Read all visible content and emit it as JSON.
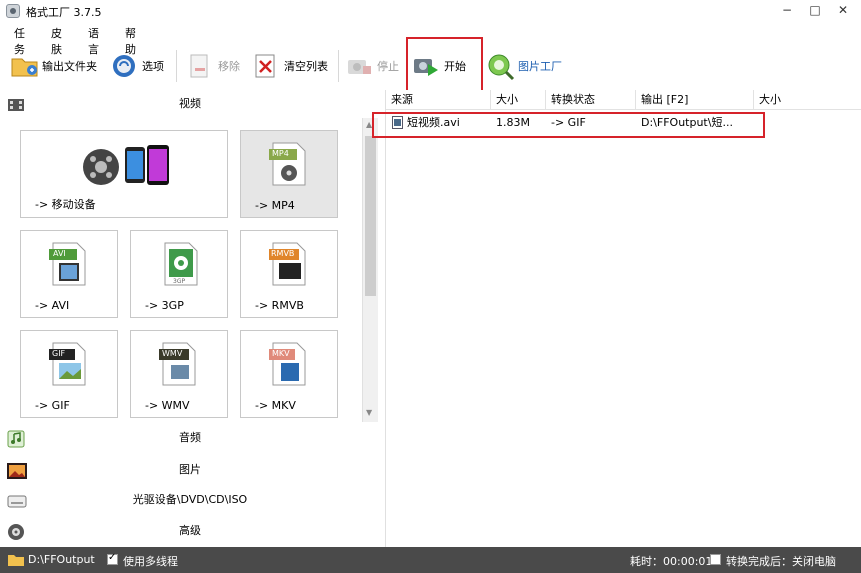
{
  "window": {
    "title": "格式工厂 3.7.5",
    "minimize": "−",
    "maximize": "□",
    "close": "✕"
  },
  "menu": [
    "任务",
    "皮肤",
    "语言",
    "帮助"
  ],
  "toolbar": {
    "output_folder": "输出文件夹",
    "options": "选项",
    "remove": "移除",
    "clear_list": "清空列表",
    "stop": "停止",
    "start": "开始",
    "picture_factory": "图片工厂"
  },
  "categories": {
    "video": "视频",
    "audio": "音频",
    "picture": "图片",
    "disc": "光驱设备\\DVD\\CD\\ISO",
    "advanced": "高级"
  },
  "video_tiles": [
    {
      "label": "-> 移动设备",
      "badge": ""
    },
    {
      "label": "-> MP4",
      "badge": "MP4"
    },
    {
      "label": "-> AVI",
      "badge": "AVI"
    },
    {
      "label": "-> 3GP",
      "badge": "3GP"
    },
    {
      "label": "-> RMVB",
      "badge": "RMVB"
    },
    {
      "label": "-> GIF",
      "badge": "GIF"
    },
    {
      "label": "-> WMV",
      "badge": "WMV"
    },
    {
      "label": "-> MKV",
      "badge": "MKV"
    }
  ],
  "table": {
    "headers": [
      "来源",
      "大小",
      "转换状态",
      "输出 [F2]",
      "大小"
    ],
    "rows": [
      {
        "source": "短视频.avi",
        "size": "1.83M",
        "status": "-> GIF",
        "output": "D:\\FFOutput\\短..."
      }
    ]
  },
  "statusbar": {
    "path": "D:\\FFOutput",
    "multithread": "使用多线程",
    "elapsed": "耗时：00:00:01",
    "after_done": "转换完成后：关闭电脑"
  },
  "colors": {
    "highlight": "#d6232a",
    "statusbar_bg": "#4a4a4a"
  }
}
